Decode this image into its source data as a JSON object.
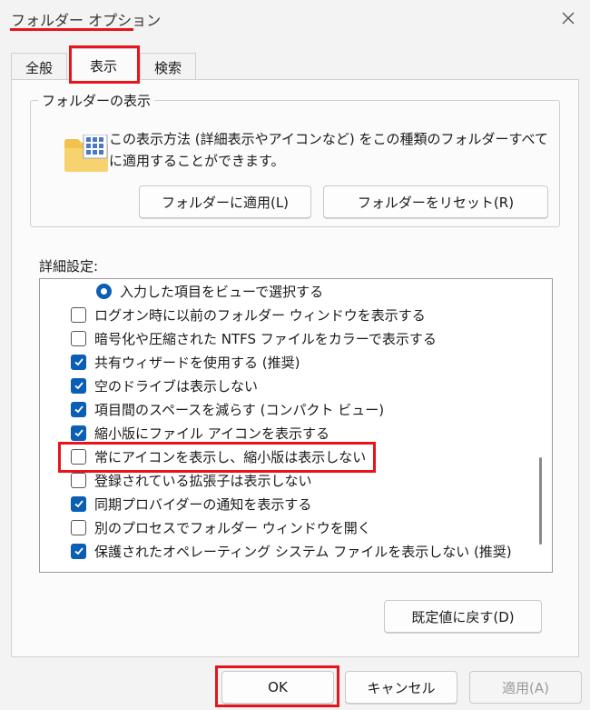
{
  "window": {
    "title": "フォルダー オプション"
  },
  "tabs": [
    {
      "label": "全般"
    },
    {
      "label": "表示"
    },
    {
      "label": "検索"
    }
  ],
  "folder_views": {
    "legend": "フォルダーの表示",
    "description": "この表示方法 (詳細表示やアイコンなど) をこの種類のフォルダーすべてに適用することができます。",
    "apply_label": "フォルダーに適用(L)",
    "reset_label": "フォルダーをリセット(R)"
  },
  "advanced": {
    "label": "詳細設定:",
    "items": [
      {
        "type": "radio",
        "label": "入力した項目をビューで選択する",
        "checked": true
      },
      {
        "type": "checkbox",
        "label": "ログオン時に以前のフォルダー ウィンドウを表示する",
        "checked": false
      },
      {
        "type": "checkbox",
        "label": "暗号化や圧縮された NTFS ファイルをカラーで表示する",
        "checked": false
      },
      {
        "type": "checkbox",
        "label": "共有ウィザードを使用する (推奨)",
        "checked": true
      },
      {
        "type": "checkbox",
        "label": "空のドライブは表示しない",
        "checked": true
      },
      {
        "type": "checkbox",
        "label": "項目間のスペースを減らす (コンパクト ビュー)",
        "checked": true
      },
      {
        "type": "checkbox",
        "label": "縮小版にファイル アイコンを表示する",
        "checked": true
      },
      {
        "type": "checkbox",
        "label": "常にアイコンを表示し、縮小版は表示しない",
        "checked": false
      },
      {
        "type": "checkbox",
        "label": "登録されている拡張子は表示しない",
        "checked": false
      },
      {
        "type": "checkbox",
        "label": "同期プロバイダーの通知を表示する",
        "checked": true
      },
      {
        "type": "checkbox",
        "label": "別のプロセスでフォルダー ウィンドウを開く",
        "checked": false
      },
      {
        "type": "checkbox",
        "label": "保護されたオペレーティング システム ファイルを表示しない (推奨)",
        "checked": true
      }
    ],
    "restore_label": "既定値に戻す(D)"
  },
  "footer": {
    "ok_label": "OK",
    "cancel_label": "キャンセル",
    "apply_label": "適用(A)"
  },
  "colors": {
    "accent": "#0a5fb4",
    "highlight": "#e8141c"
  }
}
